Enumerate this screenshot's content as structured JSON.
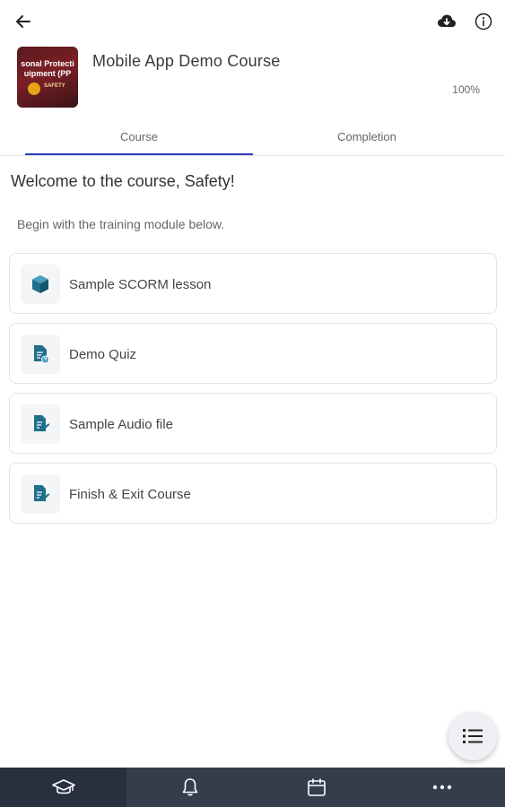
{
  "header": {
    "back_icon": "arrow-left-icon",
    "download_icon": "cloud-download-icon",
    "info_icon": "info-icon"
  },
  "course": {
    "thumbnail": {
      "line1": "sonal Protecti",
      "line2": "uipment (PP",
      "logo_text": "SAFETY"
    },
    "title": "Mobile App Demo Course",
    "progress_percent": "100%"
  },
  "tabs": [
    {
      "label": "Course",
      "active": true
    },
    {
      "label": "Completion",
      "active": false
    }
  ],
  "main": {
    "welcome": "Welcome to the course, Safety!",
    "intro": "Begin with the training module below."
  },
  "modules": [
    {
      "label": "Sample SCORM lesson",
      "icon": "scorm-package-icon"
    },
    {
      "label": "Demo Quiz",
      "icon": "quiz-document-icon"
    },
    {
      "label": "Sample Audio file",
      "icon": "document-edit-icon"
    },
    {
      "label": "Finish & Exit Course",
      "icon": "document-edit-icon"
    }
  ],
  "fab": {
    "icon": "list-icon"
  },
  "bottom_nav": [
    {
      "name": "learning",
      "icon": "graduation-cap-icon",
      "active": true
    },
    {
      "name": "notifications",
      "icon": "bell-icon",
      "active": false
    },
    {
      "name": "calendar",
      "icon": "calendar-icon",
      "active": false
    },
    {
      "name": "more",
      "icon": "more-horizontal-icon",
      "active": false
    }
  ],
  "colors": {
    "accent": "#2f3eb8",
    "nav_background": "#353d4d",
    "icon_teal": "#1f6f8b"
  }
}
